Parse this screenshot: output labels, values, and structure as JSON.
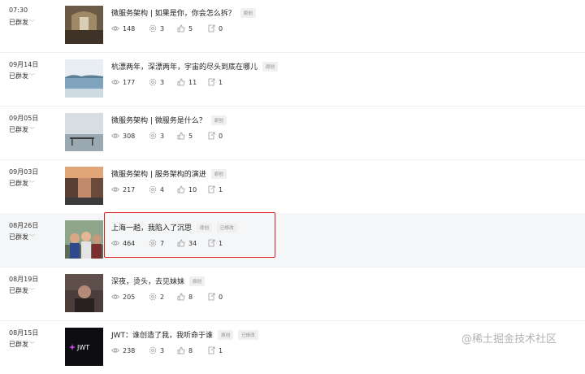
{
  "articles": [
    {
      "date": "07:30",
      "status": "已群发",
      "title": "微服务架构 | 如果是你，你会怎么拆？",
      "tags": [
        "原创"
      ],
      "views": "148",
      "likes_mid": "3",
      "likes": "5",
      "shares": "0"
    },
    {
      "date": "09月14日",
      "status": "已群发",
      "title": "杭漂两年，深漂两年，宇宙的尽头到底在哪儿",
      "tags": [
        "原创"
      ],
      "views": "177",
      "likes_mid": "3",
      "likes": "11",
      "shares": "1"
    },
    {
      "date": "09月05日",
      "status": "已群发",
      "title": "微服务架构 | 微服务是什么？",
      "tags": [
        "原创"
      ],
      "views": "308",
      "likes_mid": "3",
      "likes": "5",
      "shares": "0"
    },
    {
      "date": "09月03日",
      "status": "已群发",
      "title": "微服务架构 | 服务架构的演进",
      "tags": [
        "原创"
      ],
      "views": "217",
      "likes_mid": "4",
      "likes": "10",
      "shares": "1"
    },
    {
      "date": "08月26日",
      "status": "已群发",
      "title": "上海一趟，我陷入了沉思",
      "tags": [
        "原创",
        "已修改"
      ],
      "views": "464",
      "likes_mid": "7",
      "likes": "34",
      "shares": "1"
    },
    {
      "date": "08月19日",
      "status": "已群发",
      "title": "深夜，烫头，去见妹妹",
      "tags": [
        "原创"
      ],
      "views": "205",
      "likes_mid": "2",
      "likes": "8",
      "shares": "0"
    },
    {
      "date": "08月15日",
      "status": "已群发",
      "title": "JWT：谁创造了我，我听命于谁",
      "tags": [
        "原创",
        "已修改"
      ],
      "views": "238",
      "likes_mid": "3",
      "likes": "8",
      "shares": "1"
    }
  ],
  "thumb_logo_text": "JWT",
  "watermark": "@稀土掘金技术社区",
  "colors": {
    "highlight_border": "#e02020",
    "row_highlight": "#f5f6f7",
    "text": "#333333"
  }
}
